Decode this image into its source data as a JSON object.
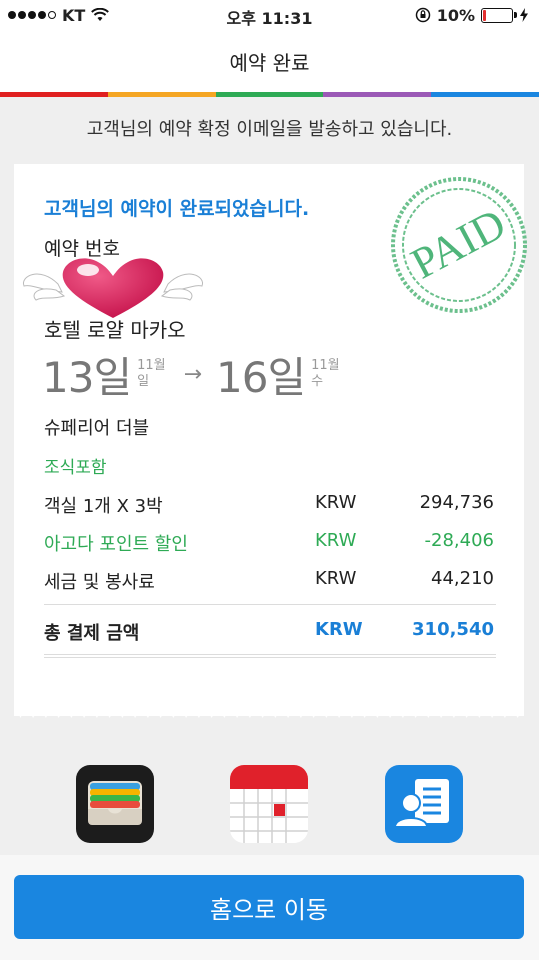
{
  "status_bar": {
    "carrier": "KT",
    "time": "오후 11:31",
    "battery": "10%",
    "battery_level": 0.1
  },
  "nav": {
    "title": "예약 완료"
  },
  "stripe_colors": [
    "#e02020",
    "#f5a623",
    "#2eaa55",
    "#9b59b6",
    "#1a86e0"
  ],
  "notice": "고객님의 예약 확정 이메일을 발송하고 있습니다.",
  "card": {
    "title": "고객님의 예약이 완료되었습니다.",
    "reservation_label": "예약 번호",
    "stamp_text": "PAID",
    "hotel_name": "호텔 로얄 마카오",
    "checkin": {
      "day": "13일",
      "month": "11월",
      "weekday": "일"
    },
    "checkout": {
      "day": "16일",
      "month": "11월",
      "weekday": "수"
    },
    "arrow": "→",
    "room_type": "슈페리어 더블",
    "breakfast": "조식포함",
    "rows": [
      {
        "name": "객실 1개 X 3박",
        "currency": "KRW",
        "amount": "294,736"
      },
      {
        "name": "아고다 포인트 할인",
        "currency": "KRW",
        "amount": "-28,406"
      },
      {
        "name": "세금 및 봉사료",
        "currency": "KRW",
        "amount": "44,210"
      }
    ],
    "total": {
      "name": "총 결제 금액",
      "currency": "KRW",
      "amount": "310,540"
    }
  },
  "actions": {
    "icons": [
      "wallet-icon",
      "calendar-icon",
      "contact-document-icon"
    ]
  },
  "home_button": "홈으로 이동",
  "colors": {
    "accent": "#1a86e0",
    "discount": "#2eaa55",
    "stamp": "#4fb57a"
  }
}
